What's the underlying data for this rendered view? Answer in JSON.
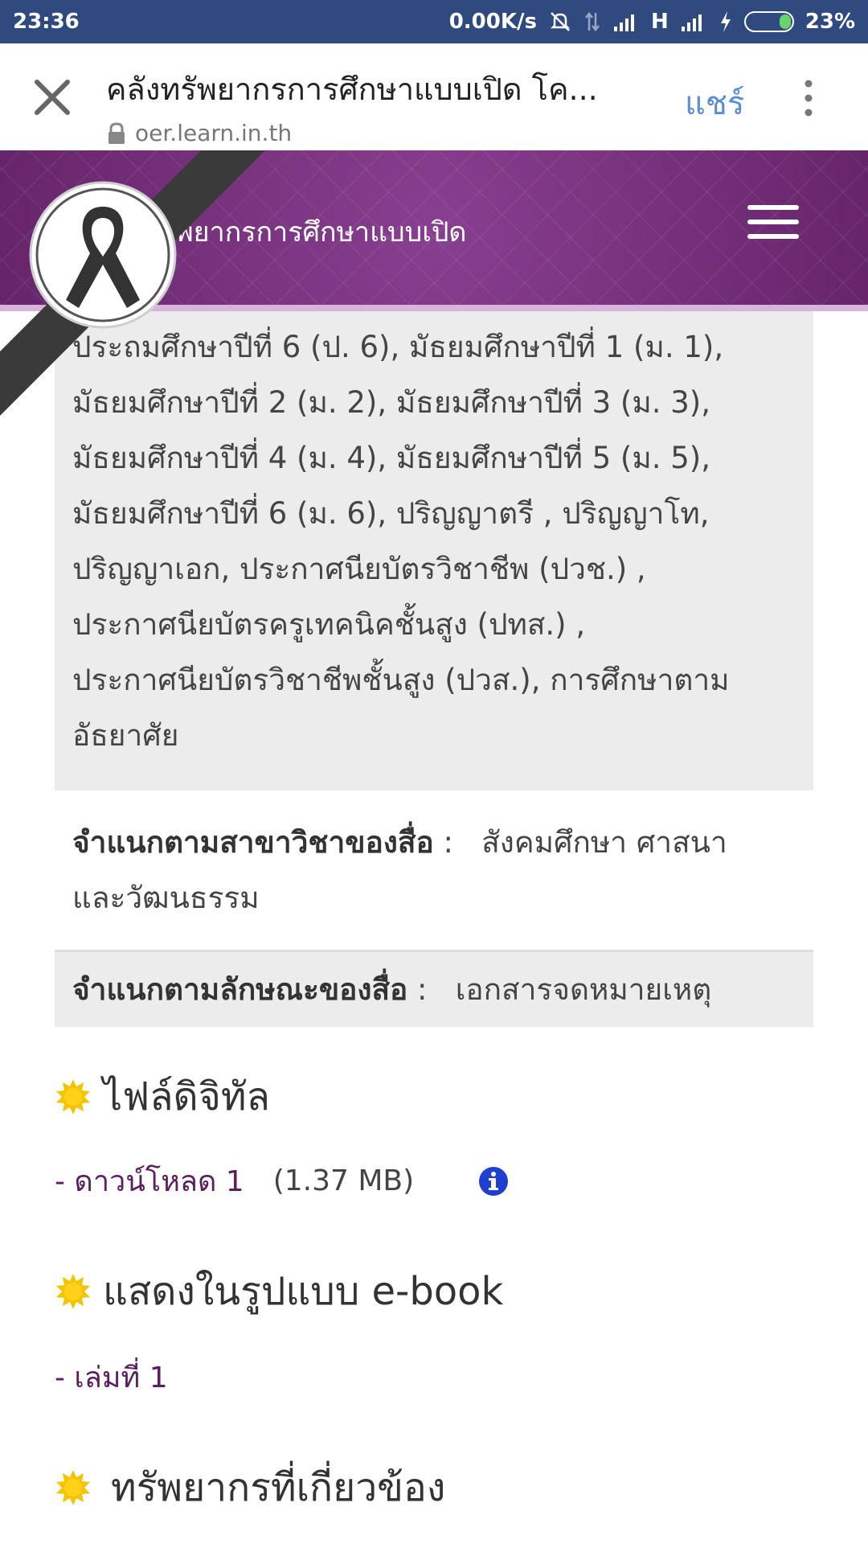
{
  "status_bar": {
    "time": "23:36",
    "network_speed": "0.00K/s",
    "network_type": "H",
    "battery_percent": "23%",
    "battery_level": 0.23,
    "icons": [
      "mute-icon",
      "data-transfer-icon",
      "signal-icon",
      "signal-icon",
      "charging-icon",
      "battery-icon"
    ]
  },
  "browser": {
    "page_title": "คลังทรัพยากรการศึกษาแบบเปิด โค...",
    "url": "oer.learn.in.th",
    "share_label": "แชร์",
    "icons": [
      "close-icon",
      "lock-icon",
      "more-vert-icon"
    ]
  },
  "site": {
    "title": "รพยากรการศึกษาแบบเปิด",
    "header_color": "#6b2a6f",
    "icons": [
      "mourning-ribbon-icon",
      "hamburger-menu-icon"
    ]
  },
  "details": {
    "levels_lines": [
      "ประถมศึกษาปีที่ 6 (ป. 6), มัธยมศึกษาปีที่ 1 (ม. 1),",
      "มัธยมศึกษาปีที่ 2 (ม. 2), มัธยมศึกษาปีที่ 3 (ม. 3),",
      "มัธยมศึกษาปีที่ 4 (ม. 4), มัธยมศึกษาปีที่ 5 (ม. 5),",
      "มัธยมศึกษาปีที่ 6 (ม. 6), ปริญญาตรี , ปริญญาโท,",
      "ปริญญาเอก, ประกาศนียบัตรวิชาชีพ (ปวช.) ,",
      "ประกาศนียบัตรครูเทคนิคชั้นสูง (ปทส.) ,",
      "ประกาศนียบัตรวิชาชีพชั้นสูง (ปวส.), การศึกษาตาม",
      "อัธยาศัย"
    ],
    "subject_label": "จำแนกตามสาขาวิชาของสื่อ",
    "subject_value_line1": "สังคมศึกษา ศาสนา",
    "subject_value_line2": "และวัฒนธรรม",
    "media_type_label": "จำแนกตามลักษณะของสื่อ",
    "media_type_value": "เอกสารจดหมายเหตุ",
    "separator": ":"
  },
  "digital_files": {
    "heading": "ไฟล์ดิจิทัล",
    "download_label": "- ดาวน์โหลด 1",
    "download_size": "(1.37 MB)",
    "icons": [
      "sun-bullet-icon",
      "info-icon"
    ]
  },
  "ebook": {
    "heading": "แสดงในรูปแบบ e-book",
    "volume_label": "- เล่มที่ 1"
  },
  "related": {
    "heading": "ทรัพยากรที่เกี่ยวข้อง"
  },
  "colors": {
    "accent_link": "#5b1e5f",
    "share_blue": "#5b8ed6",
    "status_bar": "#2e4a7e",
    "bullet_yellow": "#f5c400",
    "info_blue": "#1f3fd1"
  }
}
